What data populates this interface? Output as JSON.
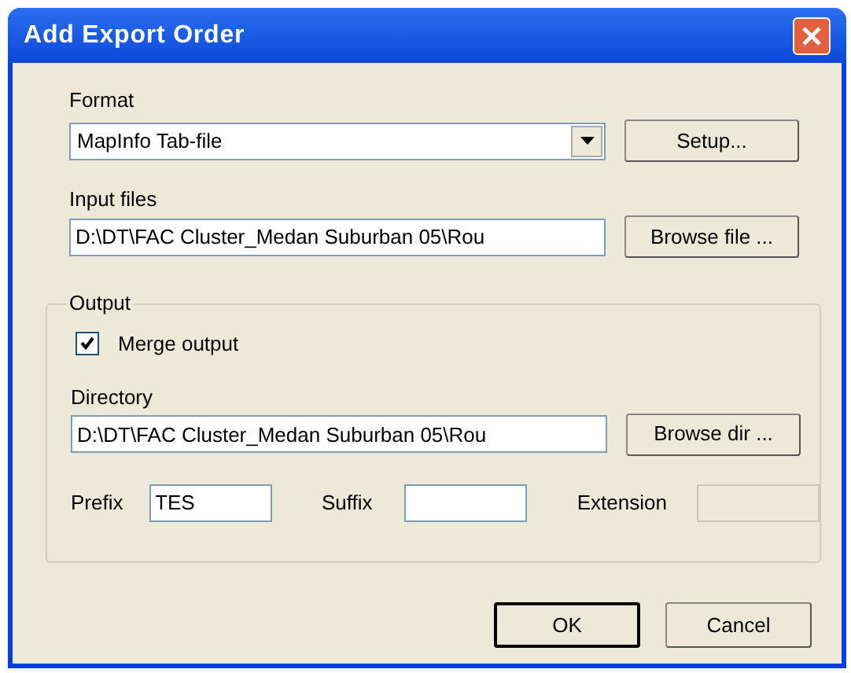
{
  "window": {
    "title": "Add Export Order"
  },
  "format": {
    "label": "Format",
    "value": "MapInfo Tab-file",
    "setup_button": "Setup..."
  },
  "input_files": {
    "label": "Input files",
    "value": "D:\\DT\\FAC Cluster_Medan Suburban 05\\Rou",
    "browse_button": "Browse file ..."
  },
  "output": {
    "legend": "Output",
    "merge": {
      "label": "Merge output",
      "checked": true
    },
    "directory": {
      "label": "Directory",
      "value": "D:\\DT\\FAC Cluster_Medan Suburban 05\\Rou",
      "browse_button": "Browse dir ..."
    },
    "fields": [
      {
        "label": "Prefix",
        "value": "TES",
        "disabled": false
      },
      {
        "label": "Suffix",
        "disabled": false
      },
      {
        "label": "Extension",
        "disabled": true
      }
    ]
  },
  "buttons": [
    {
      "label": "OK",
      "default": true
    },
    {
      "label": "Cancel",
      "default": false
    }
  ]
}
